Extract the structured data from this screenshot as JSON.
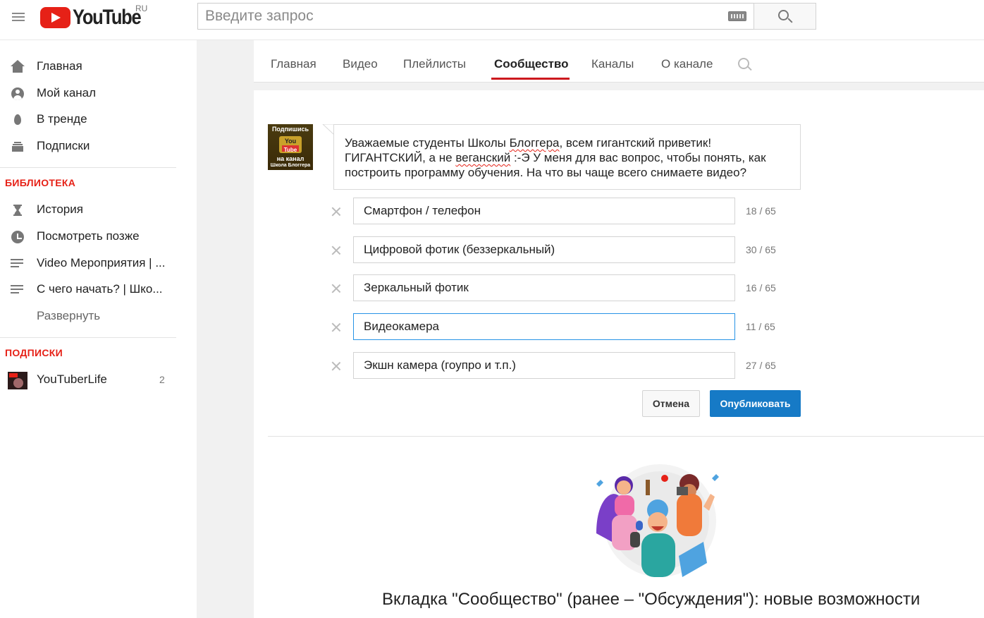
{
  "header": {
    "logo_text": "YouTube",
    "country": "RU",
    "search_placeholder": "Введите запрос"
  },
  "sidebar": {
    "main_items": [
      {
        "label": "Главная",
        "icon": "home-icon"
      },
      {
        "label": "Мой канал",
        "icon": "account-icon"
      },
      {
        "label": "В тренде",
        "icon": "trending-icon"
      },
      {
        "label": "Подписки",
        "icon": "subscriptions-icon"
      }
    ],
    "library_title": "БИБЛИОТЕКА",
    "library_items": [
      {
        "label": "История",
        "icon": "history-icon"
      },
      {
        "label": "Посмотреть позже",
        "icon": "watch-later-icon"
      },
      {
        "label": "Video Мероприятия | ...",
        "icon": "playlist-icon"
      },
      {
        "label": "С чего начать? | Шко...",
        "icon": "playlist-icon"
      }
    ],
    "expand_label": "Развернуть",
    "subscriptions_title": "ПОДПИСКИ",
    "subscriptions": [
      {
        "name": "YouTuberLife",
        "count": "2"
      }
    ]
  },
  "tabs": [
    {
      "label": "Главная"
    },
    {
      "label": "Видео"
    },
    {
      "label": "Плейлисты"
    },
    {
      "label": "Сообщество",
      "active": true
    },
    {
      "label": "Каналы"
    },
    {
      "label": "О канале"
    }
  ],
  "post": {
    "thumb_lines": [
      "Подпишись",
      "You",
      "Tube",
      "на канал",
      "Школа Блоггера"
    ],
    "text_part1": "Уважаемые студенты Школы ",
    "text_word1": "Блоггера",
    "text_part2": ", всем гигантский приветик! ГИГАНТСКИЙ, а не ",
    "text_word2": "веганский",
    "text_part3": " :-Э У меня для вас вопрос, чтобы понять, как построить программу обучения. На что вы чаще всего снимаете видео?"
  },
  "poll_options": [
    {
      "value": "Смартфон / телефон",
      "count": "18 / 65"
    },
    {
      "value": "Цифровой фотик (беззеркальный)",
      "count": "30 / 65"
    },
    {
      "value": "Зеркальный фотик",
      "count": "16 / 65"
    },
    {
      "value": "Видеокамера",
      "count": "11 / 65",
      "focused": true
    },
    {
      "value": "Экшн камера (гоупро и т.п.)",
      "count": "27 / 65"
    }
  ],
  "actions": {
    "cancel": "Отмена",
    "publish": "Опубликовать"
  },
  "caption": "Вкладка \"Сообщество\" (ранее – \"Обсуждения\"): новые возможности",
  "colors": {
    "brand_red": "#e62117",
    "tab_underline": "#cc181e",
    "publish_blue": "#167ac6",
    "focus_blue": "#2793e6"
  }
}
